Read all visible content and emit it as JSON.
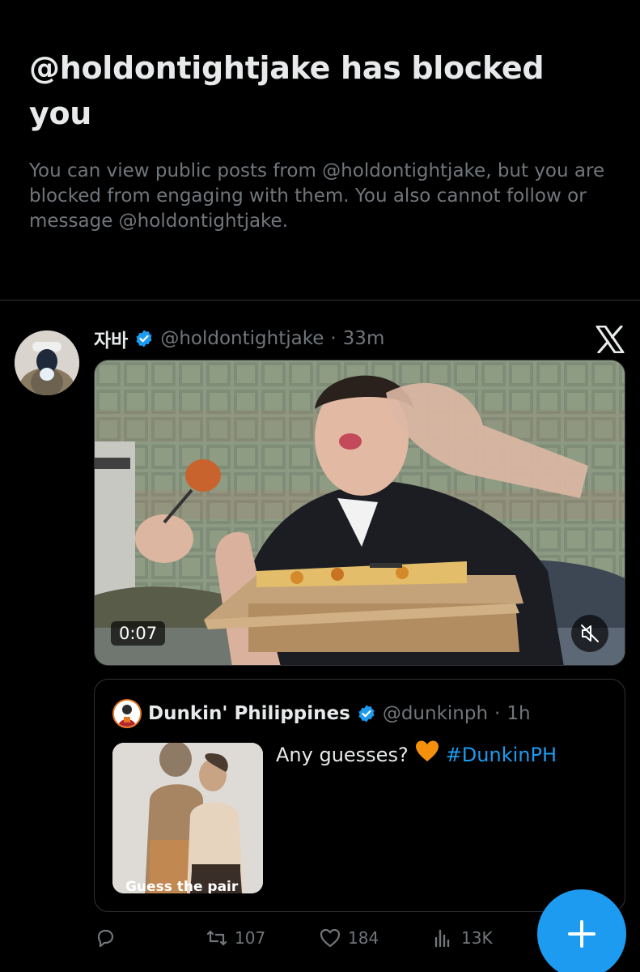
{
  "blocked_notice": {
    "title": "@holdontightjake has blocked you",
    "body": "You can view public posts from @holdontightjake, but you are blocked from engaging with them. You also cannot follow or message @holdontightjake."
  },
  "post": {
    "author_name": "자바",
    "author_handle": "@holdontightjake",
    "separator": "·",
    "time": "33m",
    "video": {
      "duration": "0:07"
    },
    "quoted": {
      "author_name": "Dunkin' Philippines",
      "author_handle": "@dunkinph",
      "separator": "·",
      "time": "1h",
      "text": "Any guesses?",
      "hashtag": "#DunkinPH",
      "thumbnail_caption": "Guess the pair"
    },
    "actions": {
      "reposts": "107",
      "likes": "184",
      "views": "13K"
    }
  },
  "colors": {
    "background": "#000000",
    "text_primary": "#e7e9ea",
    "text_secondary": "#71767b",
    "accent": "#1d9bf0",
    "border": "#2f3336"
  },
  "icons": [
    "verified-badge-icon",
    "x-logo-icon",
    "mute-icon",
    "orange-heart-emoji",
    "reply-icon",
    "repost-icon",
    "like-icon",
    "views-icon",
    "compose-plus-icon"
  ]
}
